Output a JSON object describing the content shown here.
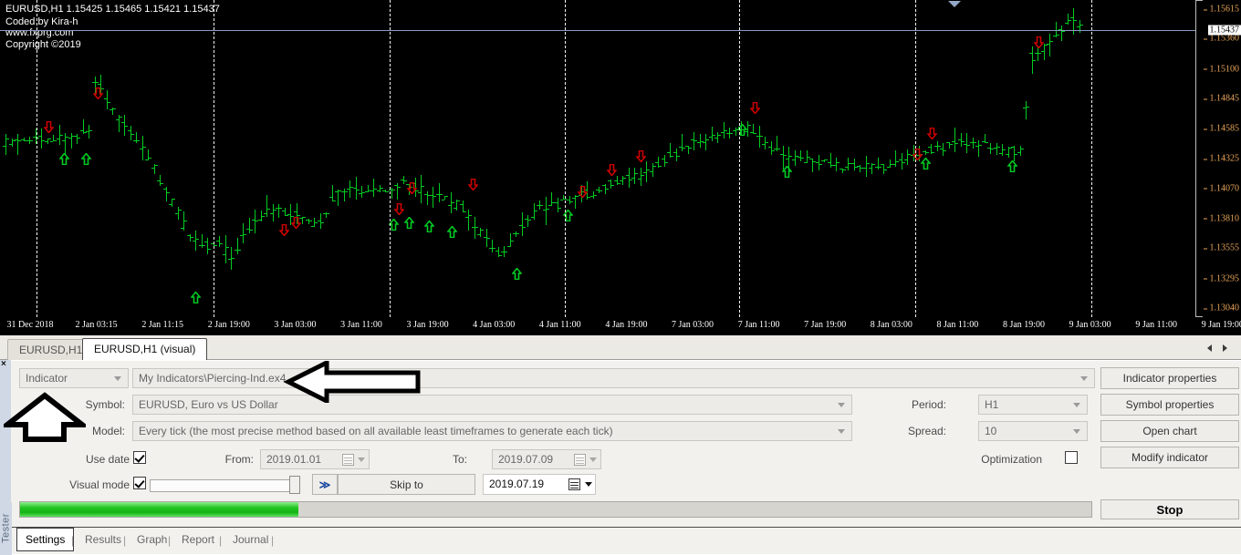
{
  "chart": {
    "header_lines": [
      "EURUSD,H1  1.15425 1.15465 1.15421 1.15437",
      "Coded by Kira-h",
      "www.fxprg.com",
      "Copyright ©2019"
    ],
    "symbol": "EURUSD,H1",
    "quote": "1.15425 1.15465 1.15421 1.15437",
    "author": "Coded by Kira-h",
    "website": "www.fxprg.com",
    "copyright": "Copyright ©2019",
    "current_price": "1.15437",
    "price_ticks": [
      "1.15615",
      "1.15360",
      "1.15100",
      "1.14845",
      "1.14585",
      "1.14325",
      "1.14070",
      "1.13810",
      "1.13555",
      "1.13295",
      "1.13040"
    ],
    "time_ticks": [
      "31 Dec 2018",
      "2 Jan 03:15",
      "2 Jan 11:15",
      "2 Jan 19:00",
      "3 Jan 03:00",
      "3 Jan 11:00",
      "3 Jan 19:00",
      "4 Jan 03:00",
      "4 Jan 11:00",
      "4 Jan 19:00",
      "7 Jan 03:00",
      "7 Jan 11:00",
      "7 Jan 19:00",
      "8 Jan 03:00",
      "8 Jan 11:00",
      "8 Jan 19:00",
      "9 Jan 03:00",
      "9 Jan 11:00",
      "9 Jan 19:00"
    ],
    "bar_color": "#00cc22",
    "sell_signal_color": "#cc0000",
    "buy_signal_color": "#00cc22",
    "background": "#000000"
  },
  "chart_data": {
    "type": "line",
    "title": "EURUSD,H1",
    "xlabel": "",
    "ylabel": "",
    "ylim": [
      1.1304,
      1.15615
    ],
    "grid": true,
    "yticks": [
      1.15615,
      1.1536,
      1.151,
      1.14845,
      1.14585,
      1.14325,
      1.1407,
      1.1381,
      1.13555,
      1.13295,
      1.1304
    ],
    "xticks": [
      "31 Dec 2018",
      "2 Jan 03:15",
      "2 Jan 11:15",
      "2 Jan 19:00",
      "3 Jan 03:00",
      "3 Jan 11:00",
      "3 Jan 19:00",
      "4 Jan 03:00",
      "4 Jan 11:00",
      "4 Jan 19:00",
      "7 Jan 03:00",
      "7 Jan 11:00",
      "7 Jan 19:00",
      "8 Jan 03:00",
      "8 Jan 11:00",
      "8 Jan 19:00",
      "9 Jan 03:00",
      "9 Jan 11:00",
      "9 Jan 19:00"
    ],
    "ohlc_last": {
      "open": 1.15425,
      "high": 1.15465,
      "low": 1.15421,
      "close": 1.15437
    },
    "price_line": 1.15437
  },
  "window_tabs": [
    {
      "label": "EURUSD,H1",
      "active": false
    },
    {
      "label": "EURUSD,H1 (visual)",
      "active": true
    }
  ],
  "settings": {
    "close_glyph": "×",
    "test_type": "Indicator",
    "expert_path": "My Indicators\\Piercing-Ind.ex4",
    "symbol_label": "Symbol:",
    "symbol_value": "EURUSD, Euro vs US Dollar",
    "model_label": "Model:",
    "model_value": "Every tick (the most precise method based on all available least timeframes to generate each tick)",
    "period_label": "Period:",
    "period_value": "H1",
    "spread_label": "Spread:",
    "spread_value": "10",
    "optimization_label": "Optimization",
    "optimization_checked": false,
    "use_date_label": "Use date",
    "use_date_checked": true,
    "from_label": "From:",
    "from_value": "2019.01.01",
    "to_label": "To:",
    "to_value": "2019.07.09",
    "visual_mode_label": "Visual mode",
    "visual_mode_checked": true,
    "skip_forward_label": "≫",
    "skip_to_label": "Skip to",
    "skip_to_date": "2019.07.19",
    "progress_percent": 26
  },
  "side_buttons": [
    {
      "label": "Indicator properties"
    },
    {
      "label": "Symbol properties"
    },
    {
      "label": "Open chart"
    },
    {
      "label": "Modify indicator"
    },
    {
      "label": "Stop"
    }
  ],
  "bottom": {
    "tester_label": "Tester",
    "tabs": [
      {
        "label": "Settings",
        "active": true
      },
      {
        "label": "Results",
        "active": false
      },
      {
        "label": "Graph",
        "active": false
      },
      {
        "label": "Report",
        "active": false
      },
      {
        "label": "Journal",
        "active": false
      }
    ]
  }
}
